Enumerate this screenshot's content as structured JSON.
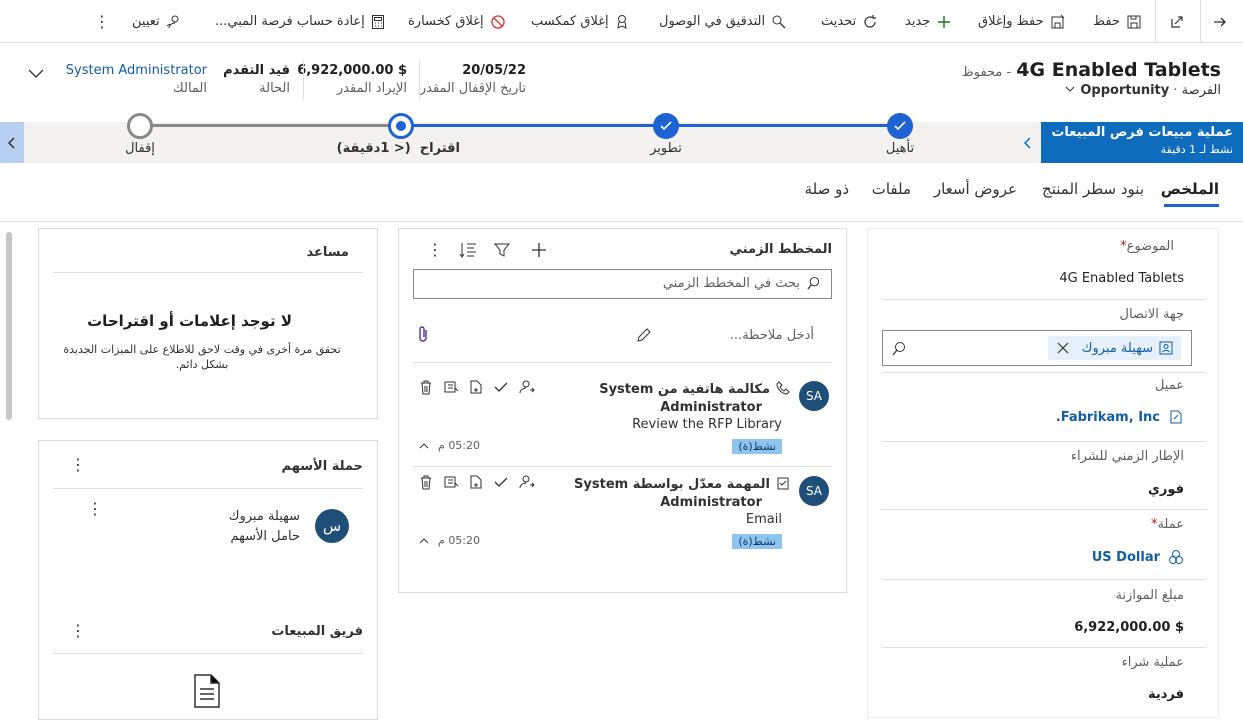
{
  "command_bar": {
    "back_label": "",
    "save": "حفظ",
    "save_close": "حفظ وإغلاق",
    "new": "جديد",
    "refresh": "تحديث",
    "check_access": "التدقيق في الوصول",
    "close_won": "إغلاق كمكسب",
    "close_lost": "إغلاق كخسارة",
    "recalculate": "إعادة حساب فرصة المبي...",
    "assign": "تعيين"
  },
  "record": {
    "title": "4G Enabled Tablets",
    "saved_status": "- محفوظ",
    "entity": "الفرصة",
    "form_selector": "Opportunity",
    "est_close_date_value": "20/05/22",
    "est_close_date_label": "تاريخ الإقفال المقدر",
    "est_revenue_value": "$ 6,922,000.00",
    "est_revenue_label": "الإيراد المقدر",
    "status_value": "قيد التقدم",
    "status_label": "الحالة",
    "owner_value": "System Administrator",
    "owner_label": "المالك"
  },
  "bpf": {
    "process_name": "عملية مبيعات فرص المبيعات",
    "process_active": "نشط لـ 1 دقيقة",
    "stages": [
      {
        "label": "تأهيل",
        "state": "completed"
      },
      {
        "label": "تطوير",
        "state": "completed"
      },
      {
        "label": "اقتراح  (< 1دقيقة)",
        "state": "active"
      },
      {
        "label": "إقفال",
        "state": "pending"
      }
    ]
  },
  "tabs": [
    {
      "label": "الملخص",
      "active": true
    },
    {
      "label": "بنود سطر المنتج",
      "active": false
    },
    {
      "label": "عروض أسعار",
      "active": false
    },
    {
      "label": "ملفات",
      "active": false
    },
    {
      "label": "ذو صلة",
      "active": false
    }
  ],
  "summary": {
    "topic_label": "الموضوع",
    "topic_value": "4G Enabled Tablets",
    "contact_label": "جهة الاتصال",
    "contact_value": "سهيلة مبروك",
    "account_label": "عميل",
    "account_value": "Fabrikam, Inc.",
    "timeframe_label": "الإطار الزمني للشراء",
    "timeframe_value": "فوري",
    "currency_label": "عملة",
    "currency_value": "US Dollar",
    "budget_label": "مبلغ الموازنة",
    "budget_value": "$ 6,922,000.00",
    "purchase_process_label": "عملية شراء",
    "purchase_process_value": "فردية"
  },
  "timeline": {
    "title": "المخطط الزمني",
    "search_placeholder": "بحث في المخطط الزمني",
    "note_placeholder": "أدخل ملاحظة...",
    "items": [
      {
        "avatar": "SA",
        "title_line1": "مكالمة هاتفية من System",
        "title_line2": "Administrator",
        "subtitle": "Review the RFP Library",
        "badge": "نشط(ة)",
        "time": "05:20 م"
      },
      {
        "avatar": "SA",
        "title_line1": "المهمة معدّل بواسطة System",
        "title_line2": "Administrator",
        "subtitle": "Email",
        "badge": "نشط(ة)",
        "time": "05:20 م"
      }
    ]
  },
  "assistant": {
    "title": "مساعد",
    "empty_title": "لا توجد إعلامات أو اقتراحات",
    "empty_body": "تحقق مرة أخرى في وقت لاحق للاطلاع على الميزات الجديدة بشكل دائم."
  },
  "stakeholders": {
    "title": "حملة الأسهم",
    "person_name": "سهيلة مبروك",
    "person_role": "حامل الأسهم",
    "avatar_letter": "س"
  },
  "sales_team": {
    "title": "فريق المبيعات"
  },
  "colors": {
    "primary": "#1d63d4",
    "bpf_active": "#0f6cbd",
    "link": "#115ea3",
    "avatar": "#1f4e79"
  }
}
